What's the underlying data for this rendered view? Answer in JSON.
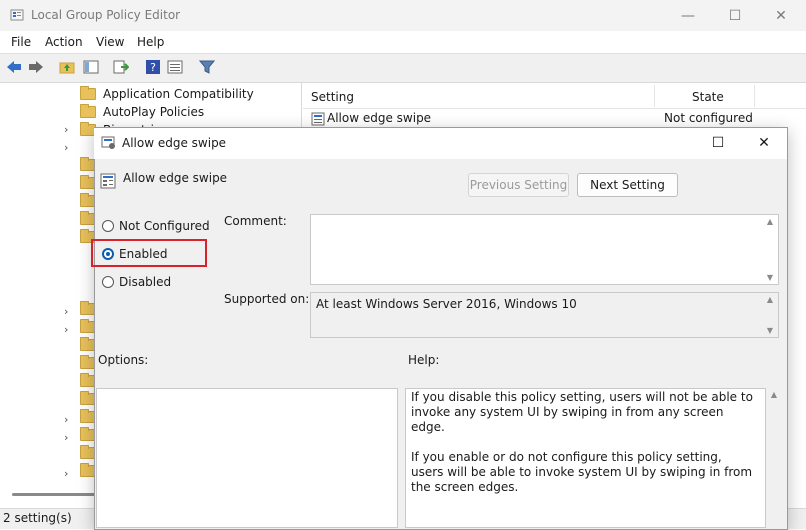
{
  "window": {
    "title": "Local Group Policy Editor",
    "controls": {
      "minimize": "—",
      "maximize": "☐",
      "close": "✕"
    }
  },
  "menu": [
    "File",
    "Action",
    "View",
    "Help"
  ],
  "tree": {
    "items": [
      {
        "label": "Application Compatibility",
        "expandable": false
      },
      {
        "label": "AutoPlay Policies",
        "expandable": false
      },
      {
        "label": "Biometrics",
        "expandable": true
      }
    ]
  },
  "list": {
    "columns": {
      "setting": "Setting",
      "state": "State"
    },
    "rows": [
      {
        "setting": "Allow edge swipe",
        "state": "Not configured"
      }
    ]
  },
  "status": {
    "text": "2 setting(s)"
  },
  "dialog": {
    "title": "Allow edge swipe",
    "header": "Allow edge swipe",
    "controls": {
      "maximize": "☐",
      "close": "✕"
    },
    "prev_button": "Previous Setting",
    "next_button": "Next Setting",
    "options": [
      {
        "label": "Not Configured",
        "selected": false
      },
      {
        "label": "Enabled",
        "selected": true
      },
      {
        "label": "Disabled",
        "selected": false
      }
    ],
    "comment_label": "Comment:",
    "comment_value": "",
    "supported_label": "Supported on:",
    "supported_value": "At least Windows Server 2016, Windows 10",
    "options_label": "Options:",
    "help_label": "Help:",
    "help_paragraphs": [
      "If you disable this policy setting, users will not be able to invoke any system UI by swiping in from any screen edge.",
      "If you enable or do not configure this policy setting, users will be able to invoke system UI by swiping in from the screen edges."
    ]
  },
  "colors": {
    "highlight": "#d9222a",
    "radio_accent": "#0b5cad",
    "folder": "#e8c15b"
  }
}
